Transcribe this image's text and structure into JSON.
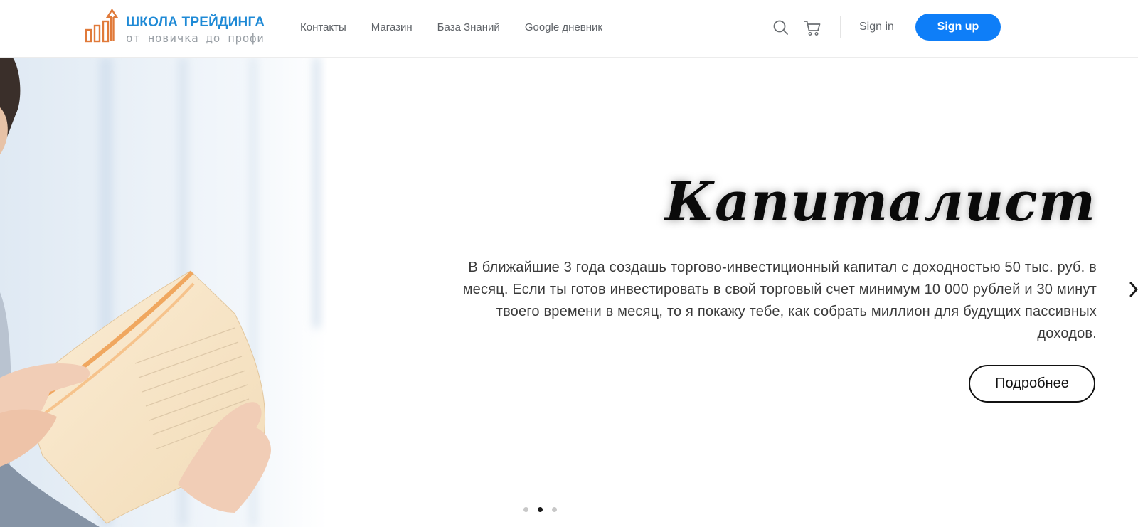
{
  "logo": {
    "title": "ШКОЛА ТРЕЙДИНГА",
    "subtitle": "от новичка до профи",
    "icon": "bar-chart-arrow-icon",
    "colors": {
      "title": "#1f8ad6",
      "mark": "#e07a3a",
      "subtitle": "#9aa0a6"
    }
  },
  "nav": {
    "items": [
      {
        "label": "Контакты"
      },
      {
        "label": "Магазин"
      },
      {
        "label": "База Знаний"
      },
      {
        "label": "Google дневник"
      }
    ]
  },
  "header_actions": {
    "search_icon": "search-icon",
    "cart_icon": "cart-icon",
    "signin_label": "Sign in",
    "signup_label": "Sign up",
    "signup_color": "#0e7ef8"
  },
  "hero": {
    "title": "Капиталист",
    "text": "В ближайшие 3 года создашь торгово-инвестиционный капитал с доходностью 50 тыс. руб. в месяц. Если ты готов инвестировать в свой торговый счет минимум 10 000 рублей и 30 минут твоего времени в месяц, то я покажу тебе, как собрать миллион для будущих пассивных доходов.",
    "button_label": "Подробнее",
    "next_icon": "chevron-right-icon",
    "slides_total": 3,
    "active_slide": 2
  }
}
